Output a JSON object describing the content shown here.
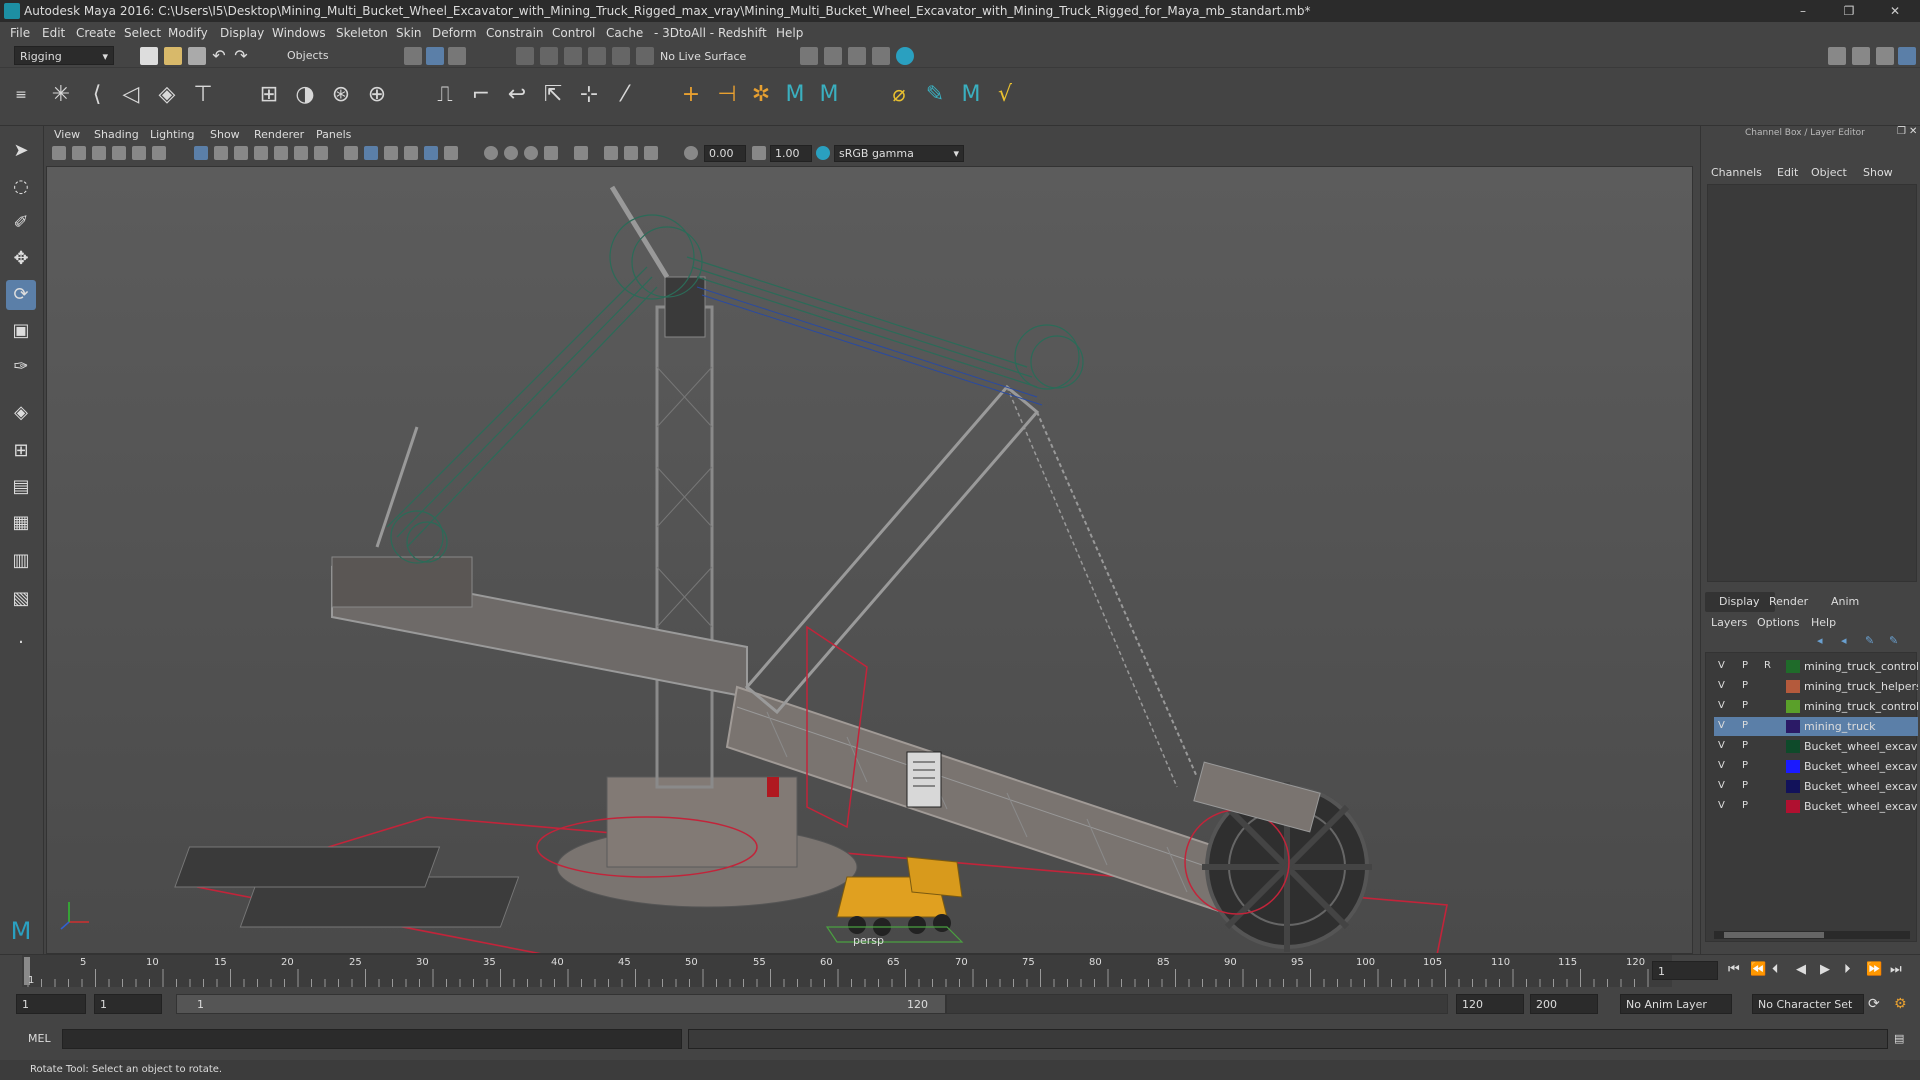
{
  "window": {
    "title": "Autodesk Maya 2016: C:\\Users\\I5\\Desktop\\Mining_Multi_Bucket_Wheel_Excavator_with_Mining_Truck_Rigged_max_vray\\Mining_Multi_Bucket_Wheel_Excavator_with_Mining_Truck_Rigged_for_Maya_mb_standart.mb*",
    "minimize": "–",
    "maximize": "❐",
    "close": "✕"
  },
  "menu": [
    "File",
    "Edit",
    "Create",
    "Select",
    "Modify",
    "Display",
    "Windows",
    "Skeleton",
    "Skin",
    "Deform",
    "Constrain",
    "Control",
    "Cache",
    "- 3DtoAll -",
    "Redshift",
    "Help"
  ],
  "status": {
    "menuset": "Rigging",
    "selection_mode": "Objects",
    "live_surface": "No Live Surface"
  },
  "panel": {
    "menus": [
      "View",
      "Shading",
      "Lighting",
      "Show",
      "Renderer",
      "Panels"
    ],
    "exposure": "0.00",
    "gamma": "1.00",
    "color_space": "sRGB gamma",
    "camera_label": "persp"
  },
  "channel_box": {
    "header": "Channel Box / Layer Editor",
    "menus": [
      "Channels",
      "Edit",
      "Object",
      "Show"
    ]
  },
  "layer_editor": {
    "tabs": [
      "Display",
      "Render",
      "Anim"
    ],
    "menus": [
      "Layers",
      "Options",
      "Help"
    ],
    "layers": [
      {
        "v": "V",
        "p": "P",
        "r": "R",
        "color": "#1f6b2a",
        "name": "mining_truck_controllers",
        "selected": false
      },
      {
        "v": "V",
        "p": "P",
        "r": "",
        "color": "#b45a3c",
        "name": "mining_truck_helpers",
        "selected": false
      },
      {
        "v": "V",
        "p": "P",
        "r": "",
        "color": "#5aa02a",
        "name": "mining_truck_controllers",
        "selected": false
      },
      {
        "v": "V",
        "p": "P",
        "r": "",
        "color": "#2b1a66",
        "name": "mining_truck",
        "selected": true
      },
      {
        "v": "V",
        "p": "P",
        "r": "",
        "color": "#0e4a2a",
        "name": "Bucket_wheel_excavator",
        "selected": false
      },
      {
        "v": "V",
        "p": "P",
        "r": "",
        "color": "#1a1aff",
        "name": "Bucket_wheel_excavator",
        "selected": false
      },
      {
        "v": "V",
        "p": "P",
        "r": "",
        "color": "#12125a",
        "name": "Bucket_wheel_excavator",
        "selected": false
      },
      {
        "v": "V",
        "p": "P",
        "r": "",
        "color": "#b01030",
        "name": "Bucket_wheel_excavator",
        "selected": false
      }
    ]
  },
  "timeline": {
    "ticks": [
      "1",
      "5",
      "10",
      "15",
      "20",
      "25",
      "30",
      "35",
      "40",
      "45",
      "50",
      "55",
      "60",
      "65",
      "70",
      "75",
      "80",
      "85",
      "90",
      "95",
      "100",
      "105",
      "110",
      "115",
      "120"
    ],
    "current_frame": "1"
  },
  "range": {
    "start": "1",
    "playback_start": "1",
    "slider_start": "1",
    "slider_end": "120",
    "playback_end": "120",
    "end": "200",
    "anim_layer": "No Anim Layer",
    "character_set": "No Character Set"
  },
  "command": {
    "label": "MEL"
  },
  "help": {
    "text": "Rotate Tool: Select an object to rotate."
  },
  "icons": {
    "select": "arrow-select-icon",
    "lasso": "lasso-icon",
    "paint": "paint-select-icon",
    "move": "move-icon",
    "rotate": "rotate-icon",
    "scale": "scale-icon"
  }
}
